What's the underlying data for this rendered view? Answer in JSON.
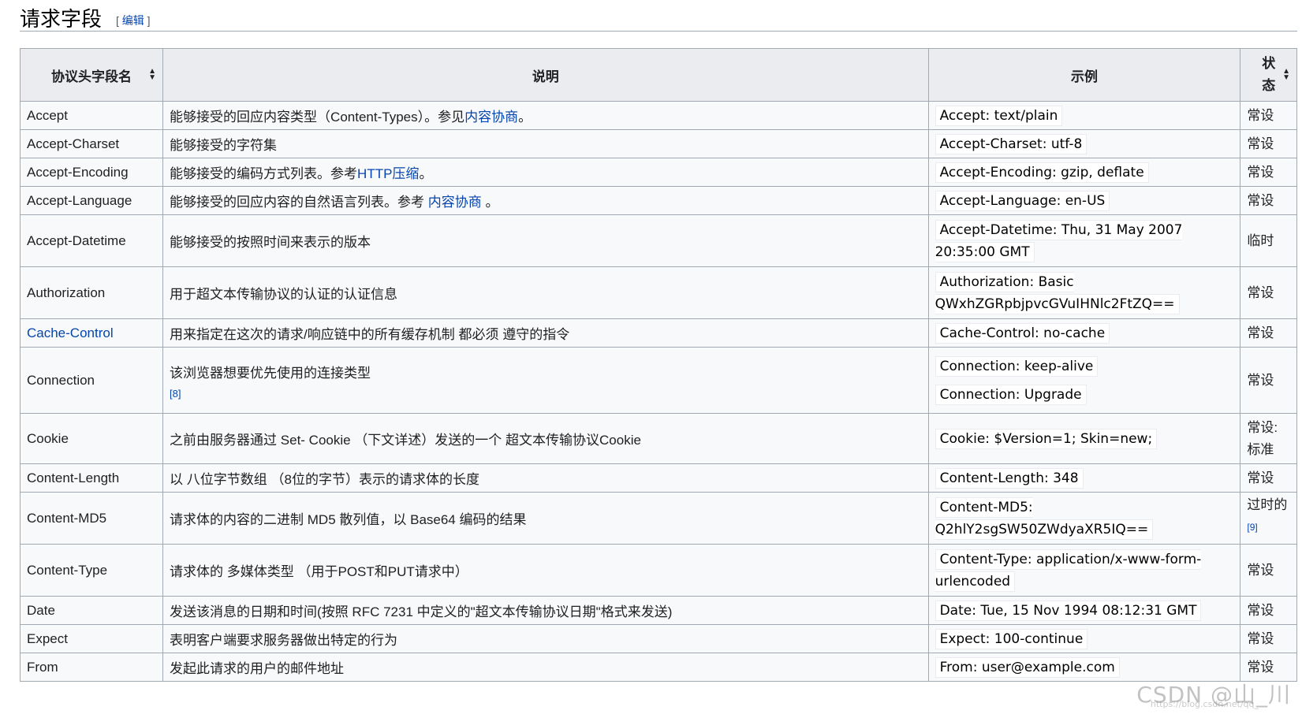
{
  "section": {
    "title": "请求字段",
    "edit_open": "[",
    "edit_label": "编辑",
    "edit_close": "]"
  },
  "table": {
    "headers": {
      "name": "协议头字段名",
      "description": "说明",
      "example": "示例",
      "status": "状态"
    },
    "rows": [
      {
        "name": "Accept",
        "desc": "能够接受的回应内容类型（Content-Types）。参见",
        "desc_link": "内容协商",
        "desc_tail": "。",
        "examples": [
          "Accept: text/plain"
        ],
        "status": "常设"
      },
      {
        "name": "Accept-Charset",
        "desc": "能够接受的字符集",
        "examples": [
          "Accept-Charset: utf-8"
        ],
        "status": "常设"
      },
      {
        "name": "Accept-Encoding",
        "desc": "能够接受的编码方式列表。参考",
        "desc_link": "HTTP压缩",
        "desc_tail": "。",
        "examples": [
          "Accept-Encoding: gzip, deflate"
        ],
        "status": "常设"
      },
      {
        "name": "Accept-Language",
        "desc": "能够接受的回应内容的自然语言列表。参考 ",
        "desc_link": "内容协商",
        "desc_tail": " 。",
        "examples": [
          "Accept-Language: en-US"
        ],
        "status": "常设"
      },
      {
        "name": "Accept-Datetime",
        "desc": "能够接受的按照时间来表示的版本",
        "examples": [
          "Accept-Datetime: Thu, 31 May 2007 20:35:00 GMT"
        ],
        "status": "临时"
      },
      {
        "name": "Authorization",
        "desc": "用于超文本传输协议的认证的认证信息",
        "examples": [
          "Authorization: Basic QWxhZGRpbjpvcGVuIHNlc2FtZQ=="
        ],
        "status": "常设"
      },
      {
        "name": "Cache-Control",
        "name_is_link": true,
        "desc": "用来指定在这次的请求/响应链中的所有缓存机制 都必须 遵守的指令",
        "examples": [
          "Cache-Control: no-cache"
        ],
        "status": "常设"
      },
      {
        "name": "Connection",
        "desc": "该浏览器想要优先使用的连接类型",
        "desc_ref": "[8]",
        "examples": [
          "Connection: keep-alive",
          "Connection: Upgrade"
        ],
        "status": "常设"
      },
      {
        "name": "Cookie",
        "desc": "之前由服务器通过 Set- Cookie （下文详述）发送的一个 超文本传输协议Cookie",
        "examples": [
          "Cookie: $Version=1; Skin=new;"
        ],
        "status": "常设: 标准"
      },
      {
        "name": "Content-Length",
        "desc": "以 八位字节数组 （8位的字节）表示的请求体的长度",
        "examples": [
          "Content-Length: 348"
        ],
        "status": "常设"
      },
      {
        "name": "Content-MD5",
        "desc": "请求体的内容的二进制 MD5 散列值，以 Base64 编码的结果",
        "examples": [
          "Content-MD5: Q2hlY2sgSW50ZWdyaXR5IQ=="
        ],
        "status": "过时的",
        "status_ref": "[9]"
      },
      {
        "name": "Content-Type",
        "desc": "请求体的 多媒体类型 （用于POST和PUT请求中）",
        "examples": [
          "Content-Type: application/x-www-form-urlencoded"
        ],
        "status": "常设"
      },
      {
        "name": "Date",
        "desc": "发送该消息的日期和时间(按照 RFC 7231 中定义的\"超文本传输协议日期\"格式来发送)",
        "examples": [
          "Date: Tue, 15 Nov 1994 08:12:31 GMT"
        ],
        "status": "常设"
      },
      {
        "name": "Expect",
        "desc": "表明客户端要求服务器做出特定的行为",
        "examples": [
          "Expect: 100-continue"
        ],
        "status": "常设"
      },
      {
        "name": "From",
        "desc": "发起此请求的用户的邮件地址",
        "examples": [
          "From: user@example.com"
        ],
        "status": "常设"
      }
    ]
  },
  "watermark": {
    "text": "CSDN @山_川",
    "small": "https://blog.csdn.net/qq_"
  },
  "colors": {
    "link": "#0645ad",
    "header_bg": "#eaecf0",
    "border": "#a2a9b1",
    "cell_bg": "#f8f9fa"
  }
}
